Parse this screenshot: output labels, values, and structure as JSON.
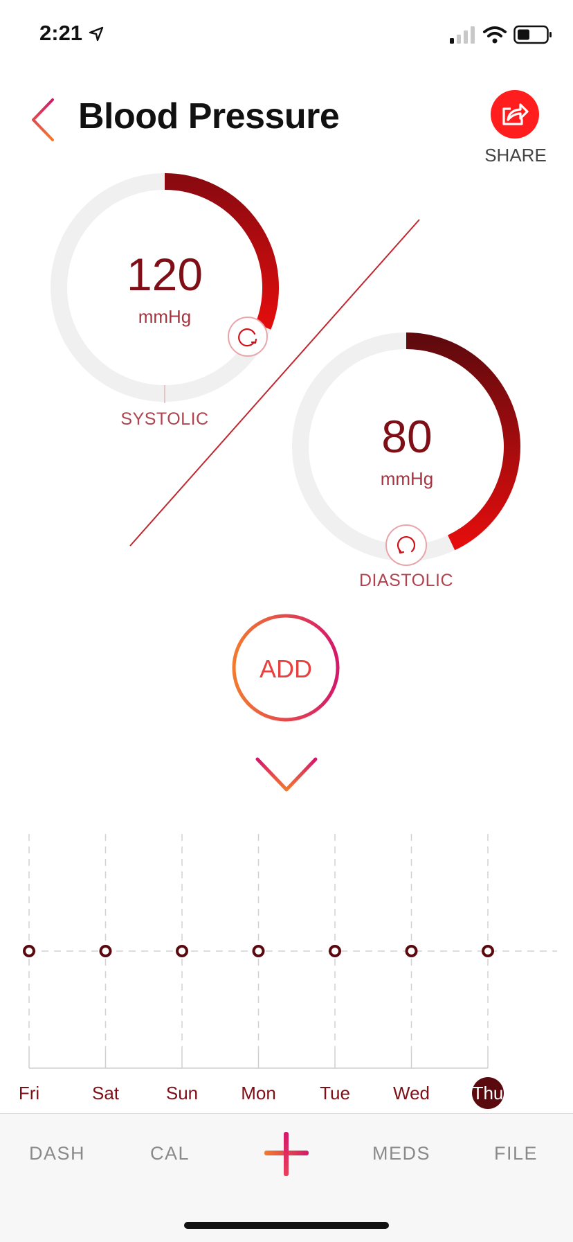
{
  "status_bar": {
    "time": "2:21"
  },
  "header": {
    "title": "Blood Pressure",
    "share_label": "SHARE"
  },
  "systolic": {
    "value": "120",
    "unit": "mmHg",
    "label": "SYSTOLIC",
    "fill_fraction": 0.31
  },
  "diastolic": {
    "value": "80",
    "unit": "mmHg",
    "label": "DIASTOLIC",
    "fill_fraction": 0.43
  },
  "add_label": "ADD",
  "chart_data": {
    "type": "line",
    "categories": [
      "Fri",
      "Sat",
      "Sun",
      "Mon",
      "Tue",
      "Wed",
      "Thu"
    ],
    "selected": "Thu",
    "series": [
      {
        "values": [
          0,
          0,
          0,
          0,
          0,
          0,
          0
        ]
      }
    ],
    "grid": true
  },
  "tabs": {
    "dash": "DASH",
    "cal": "CAL",
    "meds": "MEDS",
    "file": "FILE"
  },
  "colors": {
    "accent": "#ff1d1d",
    "dark_red": "#7e0f16",
    "orange": "#f27a2e",
    "magenta": "#d4186b"
  }
}
